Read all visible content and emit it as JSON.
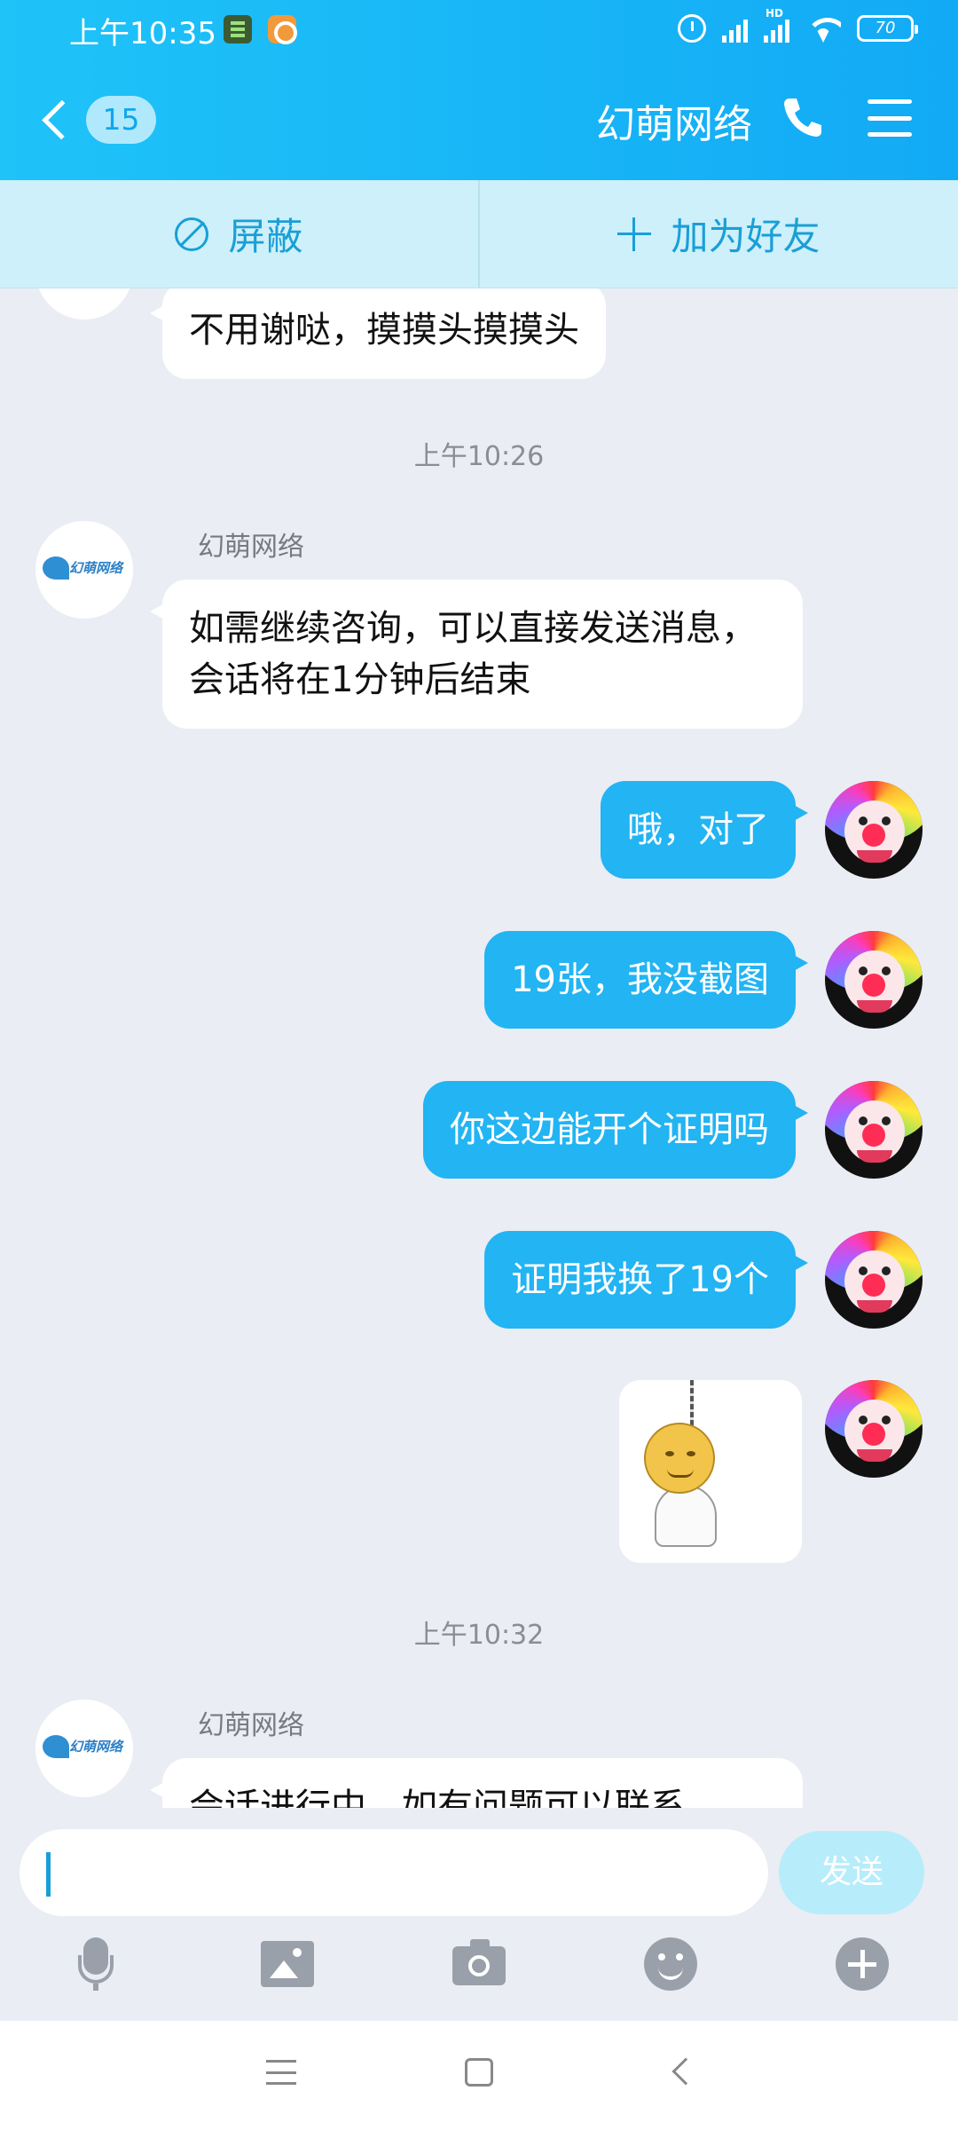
{
  "status_bar": {
    "time": "上午10:35",
    "hd": "HD",
    "battery": "70"
  },
  "header": {
    "back_count": "15",
    "title": "幻萌网络"
  },
  "actions": {
    "block_label": "屏蔽",
    "add_friend_label": "加为好友"
  },
  "messages": {
    "m1_text": "不用谢哒，摸摸头摸摸头",
    "time1": "上午10:26",
    "sender2": "幻萌网络",
    "m2_text": "如需继续咨询，可以直接发送消息，会话将在1分钟后结束",
    "m3_text": "哦，对了",
    "m4_text": "19张，我没截图",
    "m5_text": "你这边能开个证明吗",
    "m6_text": "证明我换了19个",
    "time2": "上午10:32",
    "sender7": "幻萌网络",
    "m7_text": "会话进行中，如有问题可以联系"
  },
  "avatars": {
    "logo_text": "幻萌网络"
  },
  "composer": {
    "input_value": "",
    "send_label": "发送"
  },
  "icons": {
    "header": [
      "chevron-left-icon",
      "phone-icon",
      "menu-icon"
    ],
    "actions": [
      "block-icon",
      "plus-icon"
    ],
    "toolbar": [
      "microphone-icon",
      "image-icon",
      "camera-icon",
      "emoji-icon",
      "plus-circle-icon"
    ],
    "navbar": [
      "nav-menu-icon",
      "nav-home-icon",
      "nav-back-icon"
    ]
  },
  "colors": {
    "header_accent": "#12aaf5",
    "outgoing_bubble": "#22b4f3",
    "action_bar": "#cdf0fb",
    "send_button": "#b7ecfb"
  }
}
